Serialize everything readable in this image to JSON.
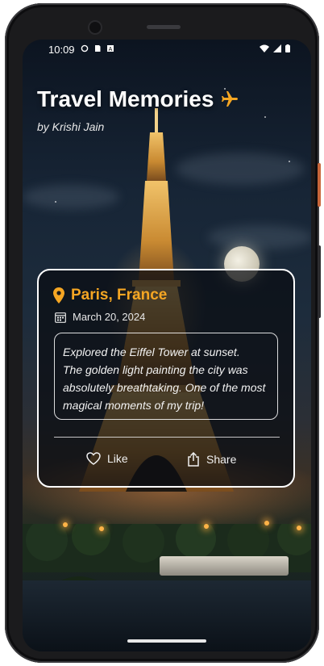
{
  "status": {
    "time": "10:09",
    "left_icons": [
      "data-saver-icon",
      "sd-card-icon",
      "a-notification-icon"
    ],
    "right_icons": [
      "wifi-icon",
      "signal-icon",
      "battery-icon"
    ]
  },
  "header": {
    "title": "Travel Memories",
    "title_icon": "airplane-icon",
    "subtitle": "by Krishi Jain"
  },
  "memory": {
    "location": "Paris, France",
    "location_icon": "location-pin-icon",
    "date": "March 20, 2024",
    "date_icon": "calendar-icon",
    "note_lines": [
      "Explored the Eiffel Tower at sunset.",
      "The golden light painting the city was",
      "absolutely breathtaking. One of the most",
      "magical moments of my trip!"
    ],
    "actions": {
      "like_label": "Like",
      "share_label": "Share"
    }
  },
  "colors": {
    "accent": "#f5a623",
    "card_border": "#ffffff",
    "text": "#ffffff"
  }
}
